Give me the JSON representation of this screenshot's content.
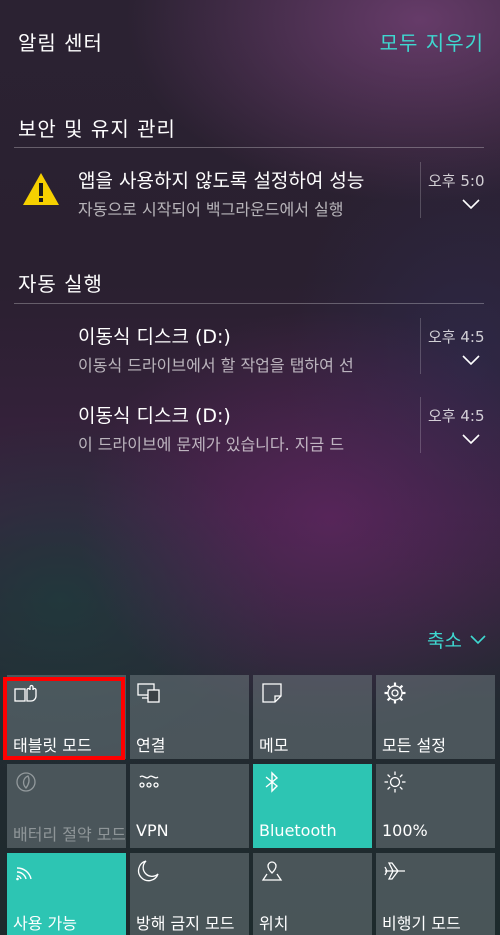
{
  "header": {
    "title": "알림 센터",
    "clear_all": "모두 지우기"
  },
  "groups": [
    {
      "title": "보안 및 유지 관리",
      "notifications": [
        {
          "title": "앱을 사용하지 않도록 설정하여 성능",
          "body": "자동으로 시작되어 백그라운드에서 실행",
          "time": "오후 5:0",
          "icon": "warning-icon"
        }
      ]
    },
    {
      "title": "자동 실행",
      "notifications": [
        {
          "title": "이동식 디스크 (D:)",
          "body": "이동식 드라이브에서 할 작업을 탭하여 선",
          "time": "오후 4:5",
          "icon": ""
        },
        {
          "title": "이동식 디스크 (D:)",
          "body": "이 드라이브에 문제가 있습니다. 지금 드",
          "time": "오후 4:5",
          "icon": ""
        }
      ]
    }
  ],
  "collapse": {
    "label": "축소"
  },
  "quick_actions": [
    {
      "label": "태블릿 모드",
      "icon": "tablet-mode-icon",
      "state": "off"
    },
    {
      "label": "연결",
      "icon": "connect-icon",
      "state": "off"
    },
    {
      "label": "메모",
      "icon": "note-icon",
      "state": "off"
    },
    {
      "label": "모든 설정",
      "icon": "gear-icon",
      "state": "off"
    },
    {
      "label": "배터리 절약 모드",
      "icon": "battery-saver-icon",
      "state": "disabled"
    },
    {
      "label": "VPN",
      "icon": "vpn-icon",
      "state": "off"
    },
    {
      "label": "Bluetooth",
      "icon": "bluetooth-icon",
      "state": "on"
    },
    {
      "label": "100%",
      "icon": "brightness-icon",
      "state": "off"
    },
    {
      "label": "사용 가능",
      "icon": "wifi-icon",
      "state": "on"
    },
    {
      "label": "방해 금지 모드",
      "icon": "moon-icon",
      "state": "off"
    },
    {
      "label": "위치",
      "icon": "location-icon",
      "state": "off"
    },
    {
      "label": "비행기 모드",
      "icon": "airplane-icon",
      "state": "off"
    }
  ],
  "colors": {
    "accent": "#3ed8d0",
    "tile_on": "#2dc5b3",
    "highlight": "#ff0000",
    "warning": "#f5d000"
  }
}
